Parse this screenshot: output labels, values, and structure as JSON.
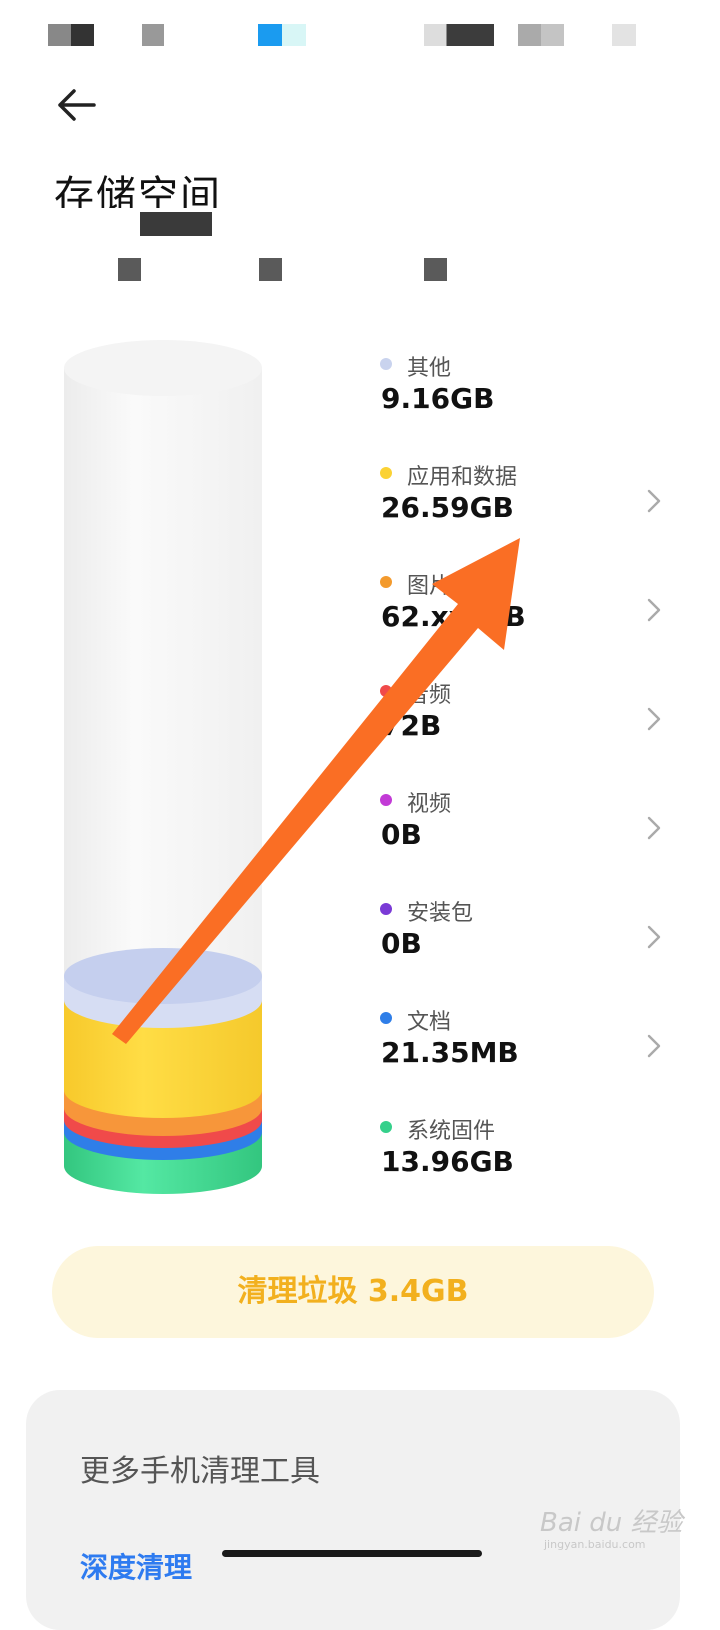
{
  "page": {
    "title": "存储空间"
  },
  "storage": {
    "items": [
      {
        "label": "其他",
        "value": "9.16GB",
        "color": "#c9d3ee",
        "has_chevron": false
      },
      {
        "label": "应用和数据",
        "value": "26.59GB",
        "color": "#fbd234",
        "has_chevron": true
      },
      {
        "label": "图片",
        "value": "62.xx MB",
        "color": "#f39a2d",
        "has_chevron": true
      },
      {
        "label": "音频",
        "value": "72B",
        "color": "#f04a4a",
        "has_chevron": true
      },
      {
        "label": "视频",
        "value": "0B",
        "color": "#c23ad6",
        "has_chevron": true
      },
      {
        "label": "安装包",
        "value": "0B",
        "color": "#7a3ad6",
        "has_chevron": true
      },
      {
        "label": "文档",
        "value": "21.35MB",
        "color": "#2f7ee8",
        "has_chevron": true
      },
      {
        "label": "系统固件",
        "value": "13.96GB",
        "color": "#35d08b",
        "has_chevron": false
      }
    ]
  },
  "actions": {
    "clean_label": "清理垃圾 3.4GB"
  },
  "tools": {
    "title": "更多手机清理工具",
    "deep_clean_label": "深度清理"
  },
  "watermark": {
    "brand": "Bai du 经验",
    "url": "jingyan.baidu.com"
  },
  "icons": {
    "back": "back-arrow-icon",
    "chevron": "chevron-right-icon"
  },
  "colors": {
    "accent_clean": "#f2b01e",
    "accent_link": "#2e7bf0",
    "annotation_arrow": "#fa6e24"
  }
}
